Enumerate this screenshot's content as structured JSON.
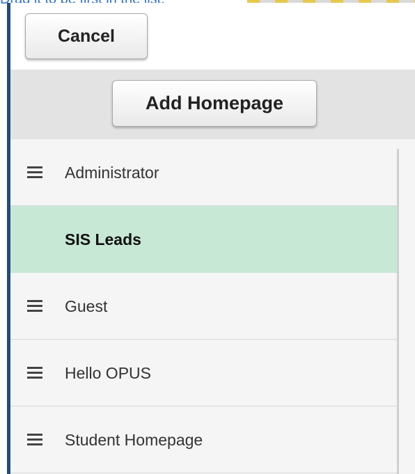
{
  "caption": "Drag it to be first in the list.",
  "buttons": {
    "cancel": "Cancel",
    "add_homepage": "Add Homepage"
  },
  "homepages": [
    {
      "label": "Administrator",
      "dragging": false
    },
    {
      "label": "SIS Leads",
      "dragging": true
    },
    {
      "label": "Guest",
      "dragging": false
    },
    {
      "label": "Hello OPUS",
      "dragging": false
    },
    {
      "label": "Student Homepage",
      "dragging": false
    }
  ],
  "colors": {
    "frame_border": "#1f4e79",
    "highlight": "#c8e8d6",
    "caption": "#2f6fd6"
  },
  "icons": {
    "drag_handle": "drag-handle-icon"
  }
}
